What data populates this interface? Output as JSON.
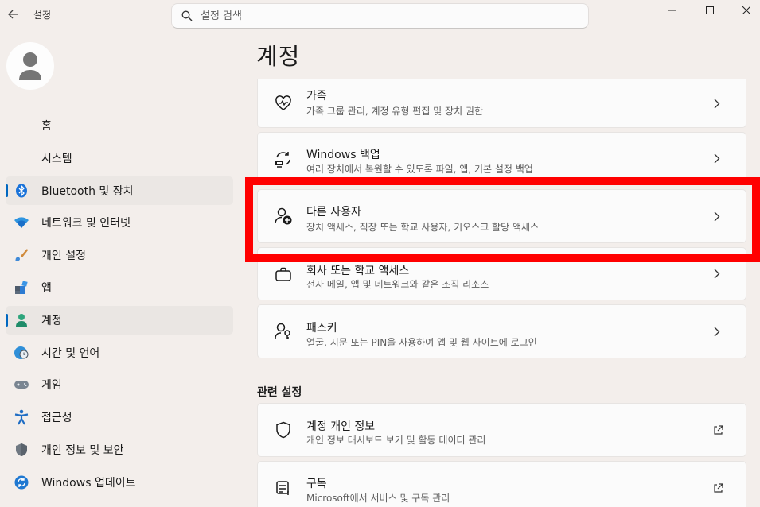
{
  "app": {
    "title": "설정"
  },
  "search": {
    "placeholder": "설정 검색"
  },
  "window_controls": {
    "minimize": "minimize-icon",
    "maximize": "maximize-icon",
    "close": "close-icon"
  },
  "sidebar": {
    "items": [
      {
        "label": "홈",
        "icon": "home-icon",
        "active": false
      },
      {
        "label": "시스템",
        "icon": "system-icon",
        "active": false
      },
      {
        "label": "Bluetooth 및 장치",
        "icon": "bluetooth-icon",
        "active": false
      },
      {
        "label": "네트워크 및 인터넷",
        "icon": "wifi-icon",
        "active": false
      },
      {
        "label": "개인 설정",
        "icon": "brush-icon",
        "active": false
      },
      {
        "label": "앱",
        "icon": "apps-icon",
        "active": false
      },
      {
        "label": "계정",
        "icon": "account-icon",
        "active": true
      },
      {
        "label": "시간 및 언어",
        "icon": "globe-clock-icon",
        "active": false
      },
      {
        "label": "게임",
        "icon": "gamepad-icon",
        "active": false
      },
      {
        "label": "접근성",
        "icon": "accessibility-icon",
        "active": false
      },
      {
        "label": "개인 정보 및 보안",
        "icon": "shield-icon",
        "active": false
      },
      {
        "label": "Windows 업데이트",
        "icon": "update-icon",
        "active": false
      }
    ]
  },
  "main": {
    "title": "계정",
    "cards": [
      {
        "title": "가족",
        "subtitle": "가족 그룹 관리, 계정 유형 편집 및 장치 권한",
        "icon": "family-heart-icon"
      },
      {
        "title": "Windows 백업",
        "subtitle": "여러 장치에서 복원할 수 있도록 파일, 앱, 기본 설정 백업",
        "icon": "backup-icon"
      },
      {
        "title": "다른 사용자",
        "subtitle": "장치 액세스, 직장 또는 학교 사용자, 키오스크 할당 액세스",
        "icon": "add-user-icon"
      },
      {
        "title": "회사 또는 학교 액세스",
        "subtitle": "전자 메일, 앱 및 네트워크와 같은 조직 리소스",
        "icon": "briefcase-icon"
      },
      {
        "title": "패스키",
        "subtitle": "얼굴, 지문 또는 PIN을 사용하여 앱 및 웹 사이트에 로그인",
        "icon": "passkey-icon"
      }
    ],
    "related_label": "관련 설정",
    "related": [
      {
        "title": "계정 개인 정보",
        "subtitle": "개인 정보 대시보드 보기 및 활동 데이터 관리",
        "icon": "shield-outline-icon"
      },
      {
        "title": "구독",
        "subtitle": "Microsoft에서 서비스 및 구독 관리",
        "icon": "subscription-icon"
      }
    ]
  },
  "colors": {
    "accent": "#0067c0",
    "highlight": "#ff0000",
    "background": "#f3eeeb",
    "card": "#fbfbfb"
  }
}
